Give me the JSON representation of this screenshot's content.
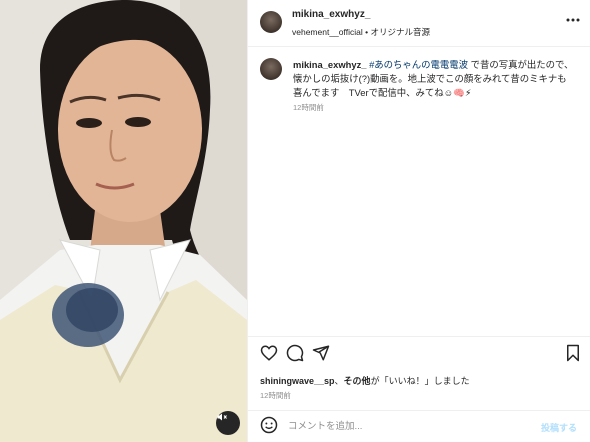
{
  "header": {
    "username": "mikina_exwhyz_",
    "audio_artist": "vehement__official",
    "separator": "•",
    "audio_label": "オリジナル音源"
  },
  "caption": {
    "username": "mikina_exwhyz_",
    "hashtag": "#あのちゃんの電電電波",
    "text": " で昔の写真が出たので、懐かしの垢抜け(?)動画を。地上波でこの顔をみれて昔のミキナも喜んでます　TVerで配信中、みてね☺🧠⚡",
    "time": "12時間前"
  },
  "likes": {
    "user": "shiningwave__sp",
    "joiner": "、",
    "others": "その他",
    "suffix": "が「いいね！」しました"
  },
  "post_time": "12時間前",
  "comment": {
    "placeholder": "コメントを追加...",
    "post_label": "投稿する"
  },
  "icons": {
    "more": "more-options-icon",
    "like": "heart-icon",
    "comment": "comment-icon",
    "share": "share-icon",
    "save": "bookmark-icon",
    "emoji": "emoji-icon",
    "mute": "muted-speaker-icon"
  },
  "colors": {
    "link": "#00376b",
    "post_button_disabled": "#b2dffc",
    "muted_text": "#8e8e8e"
  }
}
